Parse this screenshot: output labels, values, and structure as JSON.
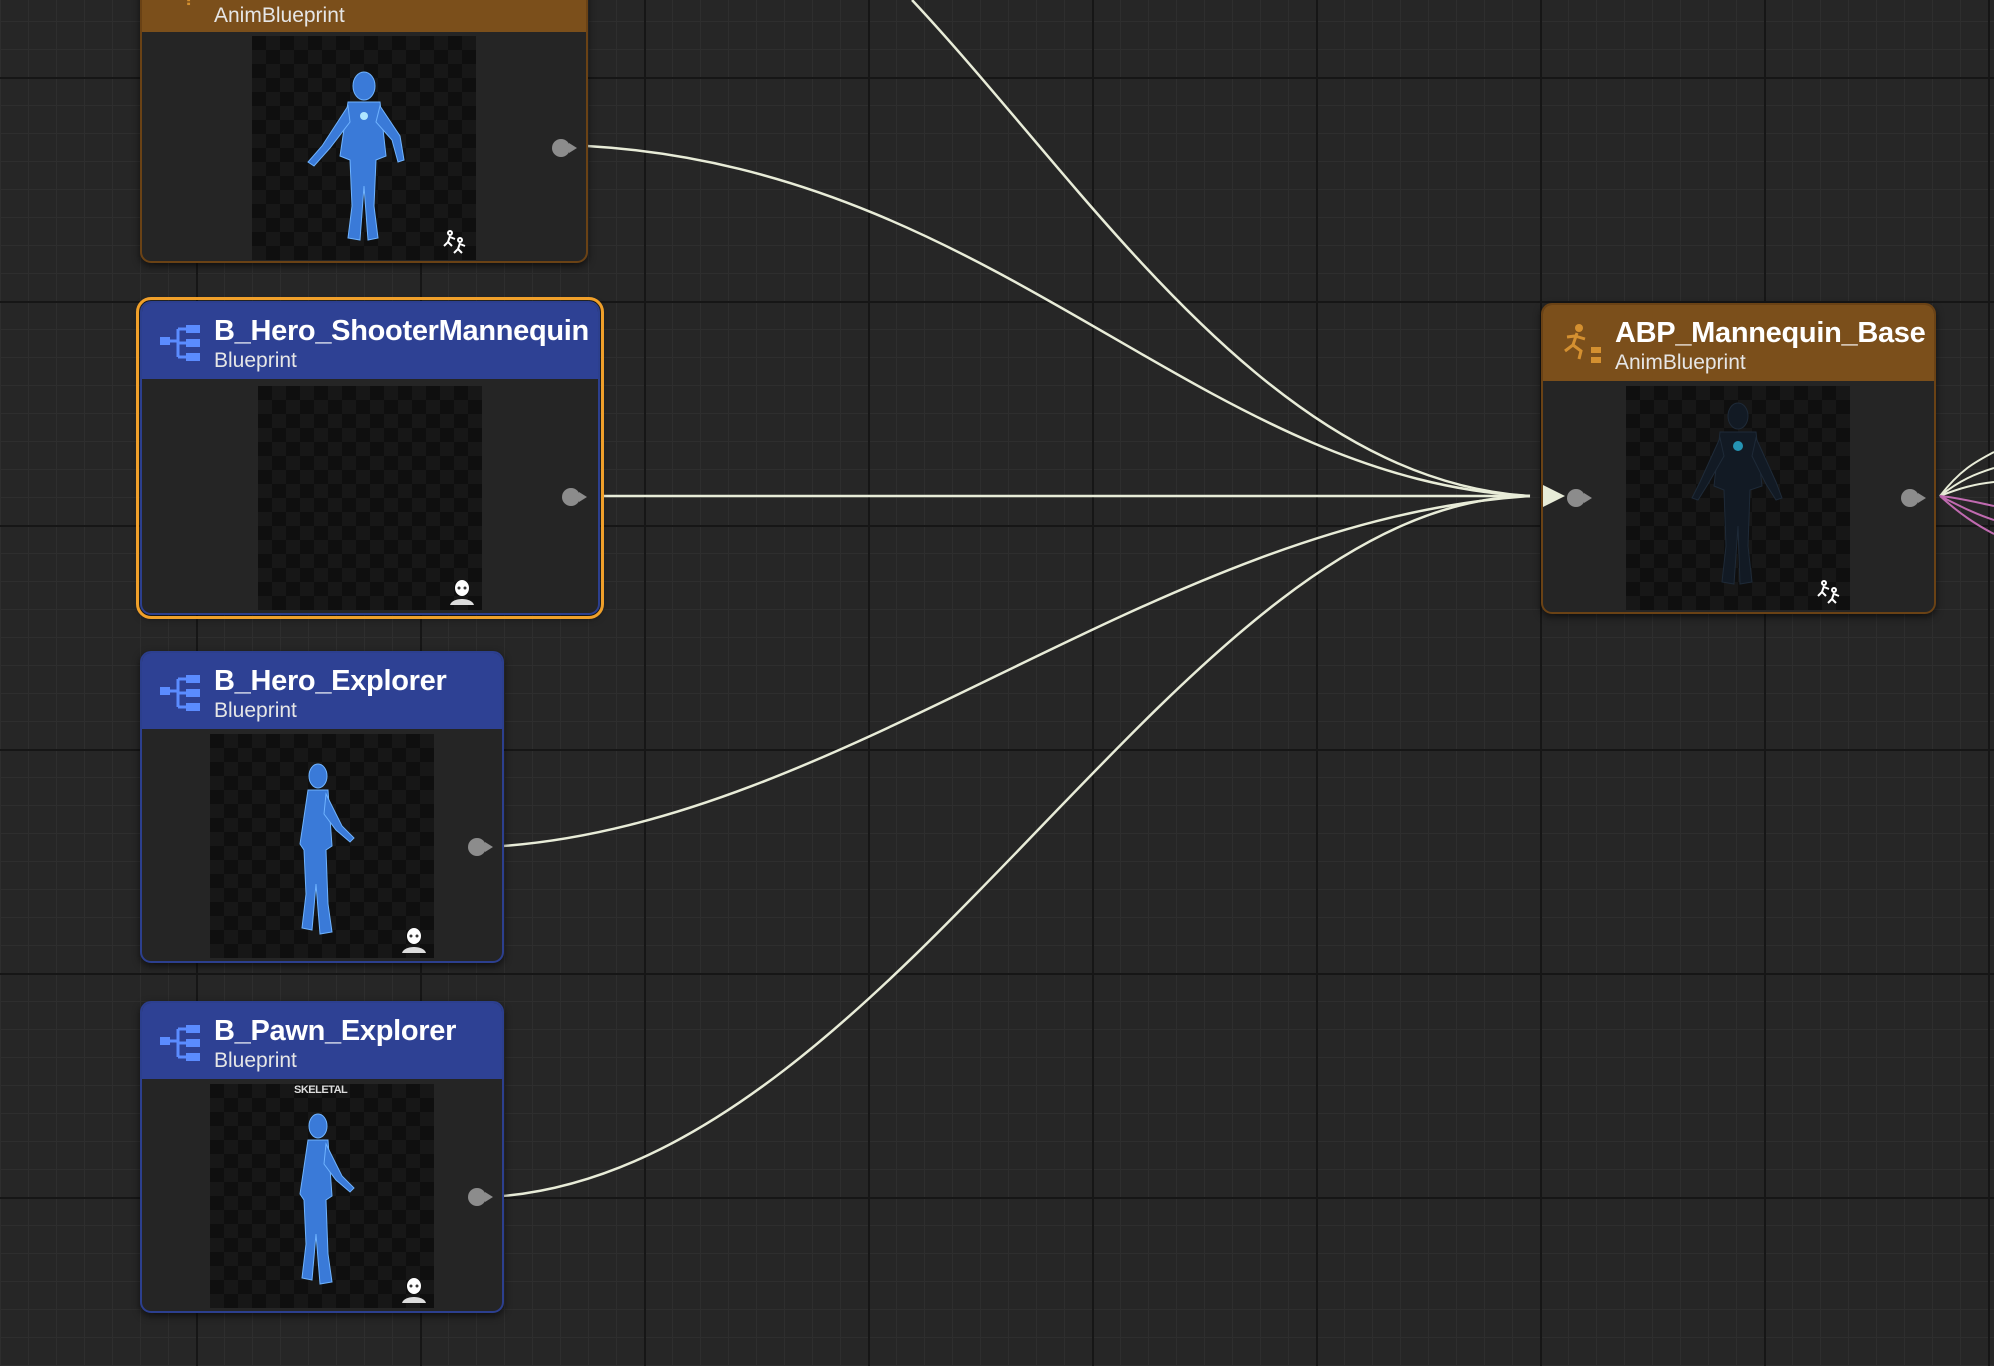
{
  "nodes": {
    "top_partial": {
      "subtitle": "AnimBlueprint"
    },
    "shooter": {
      "title": "B_Hero_ShooterMannequin",
      "subtitle": "Blueprint"
    },
    "hero_explorer": {
      "title": "B_Hero_Explorer",
      "subtitle": "Blueprint"
    },
    "pawn_explorer": {
      "title": "B_Pawn_Explorer",
      "subtitle": "Blueprint",
      "thumb_label": "SKELETAL"
    },
    "abp": {
      "title": "ABP_Mannequin_Base",
      "subtitle": "AnimBlueprint"
    }
  },
  "colors": {
    "blueprint_header": "#2e4194",
    "anim_header": "#7b4f1b",
    "selection": "#f0a02a",
    "wire": "#e8ecd8",
    "wire_out_pink": "#c06ab0"
  },
  "icons": {
    "blueprint": "blueprint-tree-icon",
    "anim": "running-figure-icon",
    "skeletal_mesh": "skeletal-mesh-icon",
    "character_badge": "character-head-icon"
  }
}
